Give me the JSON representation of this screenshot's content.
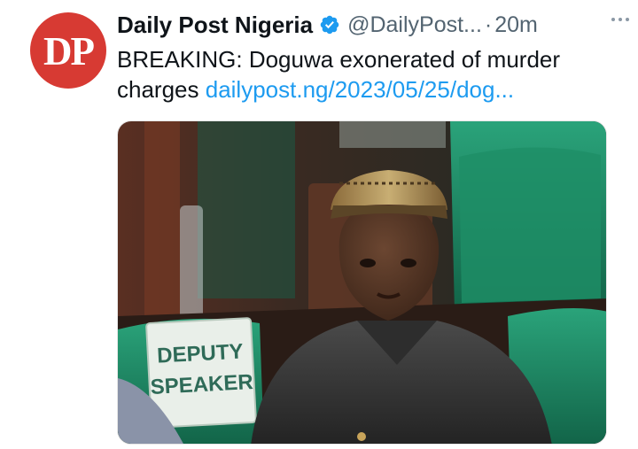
{
  "tweet": {
    "avatar_text": "DP",
    "display_name": "Daily Post Nigeria",
    "handle": "@DailyPost...",
    "separator": "·",
    "time": "20m",
    "body_text": "BREAKING: Doguwa exonerated of murder charges ",
    "link_text": "dailypost.ng/2023/05/25/dog...",
    "sign_line1": "DEPUTY",
    "sign_line2": "SPEAKER"
  },
  "colors": {
    "avatar_bg": "#d73a33",
    "link": "#1d9bf0",
    "verified": "#1d9bf0",
    "muted": "#536471",
    "chair_green": "#1f8a63"
  },
  "icons": {
    "verified": "verified-badge-icon",
    "more": "more-horizontal-icon"
  }
}
